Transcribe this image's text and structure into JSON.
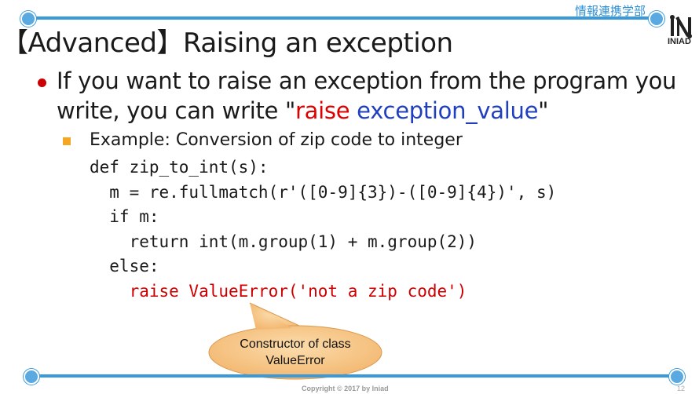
{
  "header": {
    "dept_label": "情報連携学部",
    "logo_text": "INIAD"
  },
  "slide": {
    "title": "【Advanced】Raising an exception",
    "bullet": {
      "text_before": "If you want to raise an exception from the program you write, you can write \"",
      "raise_word": "raise",
      "space": " ",
      "exception_value": "exception_value",
      "text_after": "\""
    },
    "sub_bullet": "Example: Conversion of zip code to integer",
    "code_lines": [
      "def zip_to_int(s):",
      "  m = re.fullmatch(r'([0-9]{3})-([0-9]{4})', s)",
      "  if m:",
      "    return int(m.group(1) + m.group(2))",
      "  else:"
    ],
    "code_error_line": "    raise ValueError('not a zip code')",
    "callout": "Constructor of class ValueError"
  },
  "footer": {
    "copyright": "Copyright © 2017 by Iniad",
    "page": "12"
  },
  "colors": {
    "accent": "#3a9ad9",
    "raise_red": "#dd0000",
    "value_blue": "#1f3fbf",
    "callout_fill": "#f7c27e"
  }
}
